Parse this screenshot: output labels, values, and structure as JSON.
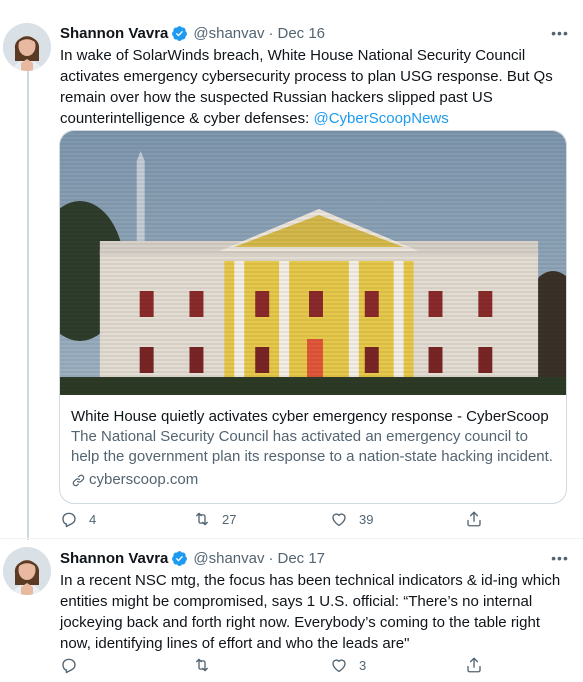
{
  "tweets": [
    {
      "author_name": "Shannon Vavra",
      "handle": "@shanvav",
      "separator": "·",
      "date": "Dec 16",
      "more_label": "•••",
      "text": "In wake of SolarWinds breach, White House National Security Council activates emergency cybersecurity process to plan USG response. But Qs remain over how the suspected Russian hackers slipped past US counterintelligence & cyber defenses: ",
      "mention": "@CyberScoopNews",
      "card": {
        "title": "White House quietly activates cyber emergency response - CyberScoop",
        "description": "The National Security Council has activated an emergency council to help the government plan its response to a nation-state hacking incident.",
        "domain": "cyberscoop.com"
      },
      "replies": "4",
      "retweets": "27",
      "likes": "39"
    },
    {
      "author_name": "Shannon Vavra",
      "handle": "@shanvav",
      "separator": "·",
      "date": "Dec 17",
      "more_label": "•••",
      "text": "In a recent NSC mtg, the focus has been technical indicators & id-ing which entities might be compromised, says 1 U.S. official: “There’s no internal jockeying back and forth right now. Everybody’s coming to the table right now, identifying lines of effort and who the leads are\"",
      "replies": "",
      "retweets": "",
      "likes": "3"
    }
  ],
  "colors": {
    "accent": "#1d9bf0",
    "text_primary": "#0f1419",
    "text_secondary": "#536471",
    "border": "#cfd9de"
  },
  "icons": [
    "verified-badge-icon",
    "more-icon",
    "link-icon",
    "reply-icon",
    "retweet-icon",
    "like-icon",
    "share-icon"
  ]
}
